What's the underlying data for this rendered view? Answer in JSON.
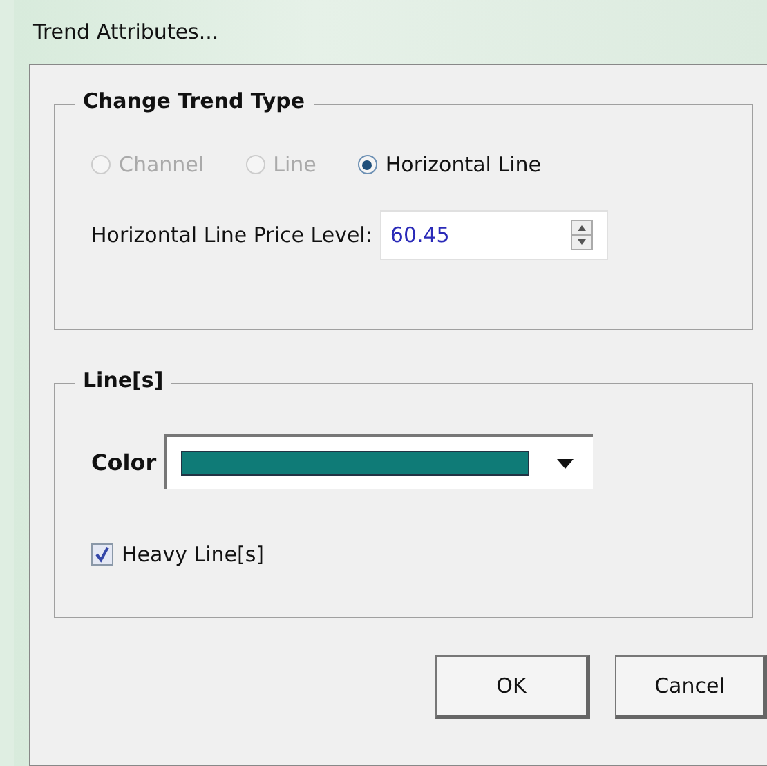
{
  "window": {
    "title": "Trend Attributes..."
  },
  "trend_type": {
    "title": "Change Trend Type",
    "options": [
      {
        "label": "Channel",
        "selected": false,
        "disabled": true
      },
      {
        "label": "Line",
        "selected": false,
        "disabled": true
      },
      {
        "label": "Horizontal Line",
        "selected": true,
        "disabled": false
      }
    ],
    "price_level": {
      "label": "Horizontal Line Price Level:",
      "value": "60.45"
    }
  },
  "lines": {
    "title": "Line[s]",
    "color_label": "Color",
    "color": "#0f7b77",
    "heavy": {
      "label": "Heavy Line[s]",
      "checked": true
    }
  },
  "buttons": [
    "OK",
    "Cancel"
  ]
}
